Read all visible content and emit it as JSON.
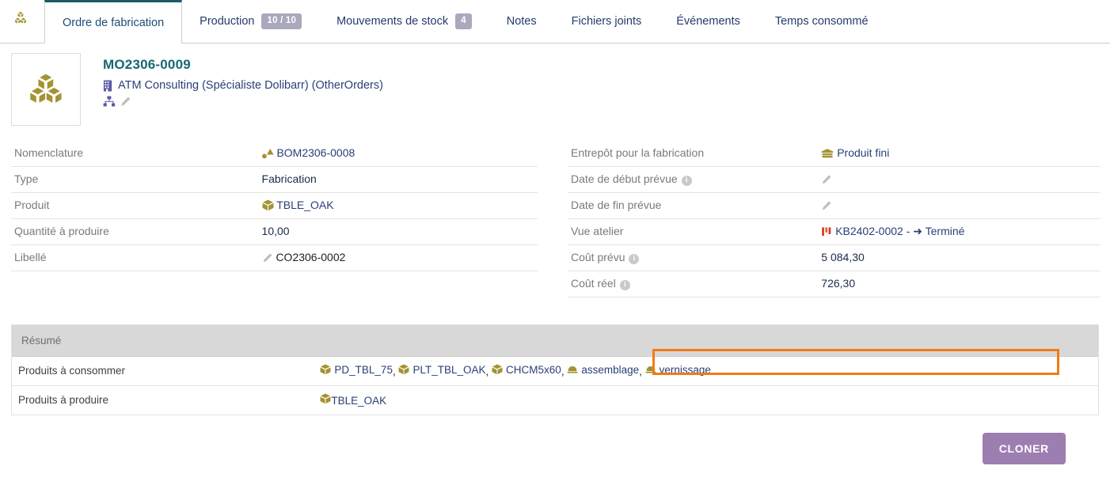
{
  "colors": {
    "accent_teal": "#16686e",
    "link_indigo": "#2a3f77",
    "icon_olive": "#a39332",
    "highlight_orange": "#f07c17",
    "badge_grey": "#a9a8bd",
    "clone_purple": "#9d7eb0",
    "resume_header_grey": "#d8d8d8"
  },
  "tabbar": {
    "leading_icon": "boxes-icon",
    "tabs": [
      {
        "label": "Ordre de fabrication",
        "badge": null,
        "active": true
      },
      {
        "label": "Production",
        "badge": "10 / 10",
        "active": false
      },
      {
        "label": "Mouvements de stock",
        "badge": "4",
        "active": false
      },
      {
        "label": "Notes",
        "badge": null,
        "active": false
      },
      {
        "label": "Fichiers joints",
        "badge": null,
        "active": false
      },
      {
        "label": "Événements",
        "badge": null,
        "active": false
      },
      {
        "label": "Temps consommé",
        "badge": null,
        "active": false
      }
    ]
  },
  "banner": {
    "thumbnail_icon": "boxes-icon",
    "reference": "MO2306-0009",
    "thirdparty_icon": "building-icon",
    "thirdparty": "ATM Consulting (Spécialiste Dolibarr) (OtherOrders)",
    "action_icons": [
      "sitemap-icon",
      "pencil-icon"
    ]
  },
  "left_fields": [
    {
      "label": "Nomenclature",
      "icon": "shapes-icon",
      "value": "BOM2306-0008",
      "style": "link"
    },
    {
      "label": "Type",
      "icon": null,
      "value": "Fabrication",
      "style": "plain"
    },
    {
      "label": "Produit",
      "icon": "cube-icon",
      "value": "TBLE_OAK",
      "style": "link"
    },
    {
      "label": "Quantité à produire",
      "icon": null,
      "value": "10,00",
      "style": "plain"
    },
    {
      "label": "Libellé",
      "icon": "pencil-icon",
      "value": "CO2306-0002",
      "style": "plain"
    }
  ],
  "right_fields": [
    {
      "label": "Entrepôt pour la fabrication",
      "info": false,
      "icon": "warehouse-icon",
      "value": "Produit fini",
      "style": "link",
      "highlight": false
    },
    {
      "label": "Date de début prévue",
      "info": true,
      "icon": "pencil-icon",
      "value": "",
      "style": "plain",
      "highlight": false
    },
    {
      "label": "Date de fin prévue",
      "info": false,
      "icon": "pencil-icon",
      "value": "",
      "style": "plain",
      "highlight": false
    },
    {
      "label": "Vue atelier",
      "info": false,
      "icon": "kanban-icon",
      "value": "KB2402-0002 - ➜ Terminé",
      "style": "link",
      "highlight": true
    },
    {
      "label": "Coût prévu",
      "info": true,
      "icon": null,
      "value": "5 084,30",
      "style": "plain",
      "highlight": false
    },
    {
      "label": "Coût réel",
      "info": true,
      "icon": null,
      "value": "726,30",
      "style": "plain",
      "highlight": false
    }
  ],
  "resume": {
    "header": "Résumé",
    "rows": [
      {
        "label": "Produits à consommer",
        "items": [
          {
            "icon": "cube-icon",
            "label": "PD_TBL_75"
          },
          {
            "icon": "cube-icon",
            "label": "PLT_TBL_OAK"
          },
          {
            "icon": "cube-icon",
            "label": "CHCM5x60"
          },
          {
            "icon": "bell-icon",
            "label": "assemblage"
          },
          {
            "icon": "bell-icon",
            "label": "vernissage"
          }
        ]
      },
      {
        "label": "Produits à produire",
        "items": [
          {
            "icon": "cube-icon",
            "label": "TBLE_OAK"
          }
        ]
      }
    ]
  },
  "actions": {
    "clone_label": "CLONER"
  }
}
